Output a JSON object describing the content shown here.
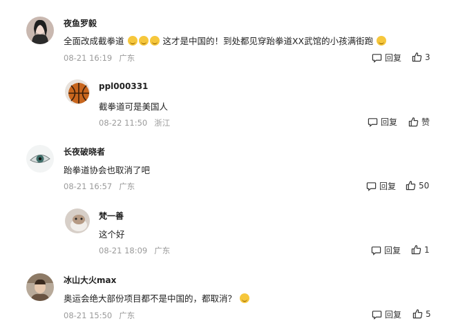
{
  "comments": [
    {
      "author": "夜鱼罗毅",
      "text_a": "全面改成截拳道",
      "text_b": "这才是中国的！到处都见穿跆拳道XX武馆的小孩满街跑",
      "date": "08-21 16:19",
      "location": "广东",
      "reply_label": "回复",
      "likes": "3"
    },
    {
      "author": "ppl000331",
      "text": "截拳道可是美国人",
      "date": "08-22 11:50",
      "location": "浙江",
      "reply_label": "回复",
      "likes": "赞"
    },
    {
      "author": "长夜破晓者",
      "text": "跆拳道协会也取消了吧",
      "date": "08-21 16:57",
      "location": "广东",
      "reply_label": "回复",
      "likes": "50"
    },
    {
      "author": "梵一善",
      "text": "这个好",
      "date": "08-21 18:09",
      "location": "广东",
      "reply_label": "回复",
      "likes": "1"
    },
    {
      "author": "冰山大火max",
      "text_a": "奥运会绝大部份项目都不是中国的，都取消？",
      "date": "08-21 15:50",
      "location": "广东",
      "reply_label": "回复",
      "likes": "5"
    }
  ],
  "icons": {
    "reply": "comment-bubble-icon",
    "like": "thumbs-up-icon",
    "emoji": "smile-emoji-icon"
  }
}
